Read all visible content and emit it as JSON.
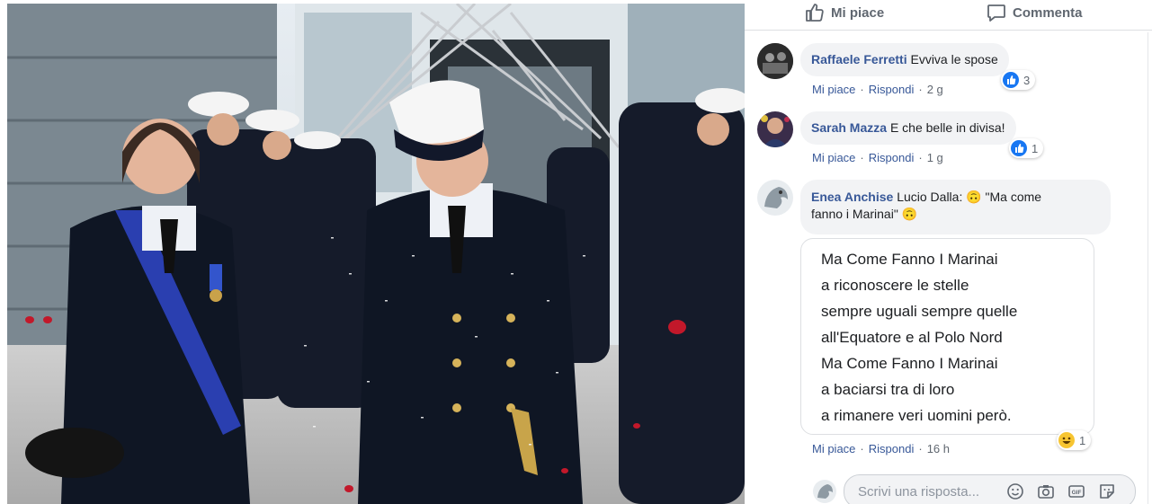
{
  "actions": {
    "like_label": "Mi piace",
    "comment_label": "Commenta"
  },
  "comments": [
    {
      "author": "Raffaele Ferretti",
      "text": "Evviva le spose",
      "like": "Mi piace",
      "reply": "Rispondi",
      "time": "2 g",
      "reaction": "like",
      "reaction_count": "3"
    },
    {
      "author": "Sarah Mazza",
      "text": "E che belle in divisa!",
      "like": "Mi piace",
      "reply": "Rispondi",
      "time": "1 g",
      "reaction": "like",
      "reaction_count": "1"
    },
    {
      "author": "Enea Anchise",
      "text_line1": "Lucio Dalla: 🙃 \"Ma come",
      "text_line2": "fanno i Marinai\" 🙃",
      "like": "Mi piace",
      "reply": "Rispondi",
      "time": "16 h",
      "reaction": "haha",
      "reaction_count": "1",
      "attachment_lines": [
        "Ma Come Fanno I Marinai",
        "a riconoscere le stelle",
        "sempre uguali sempre quelle",
        "all'Equatore e al Polo Nord",
        "Ma Come Fanno I Marinai",
        "a baciarsi tra di loro",
        "a rimanere veri uomini però."
      ]
    }
  ],
  "reply_box": {
    "placeholder": "Scrivi una risposta..."
  },
  "icons": {
    "like": "thumbs-up-icon",
    "comment": "speech-bubble-icon",
    "emoji": "smiley-icon",
    "camera": "camera-icon",
    "gif": "gif-icon",
    "sticker": "sticker-icon"
  },
  "colors": {
    "link": "#385898",
    "meta": "#606770",
    "bubble": "#f2f3f5",
    "like_reaction": "#1877f2",
    "haha_reaction": "#f7c531"
  }
}
